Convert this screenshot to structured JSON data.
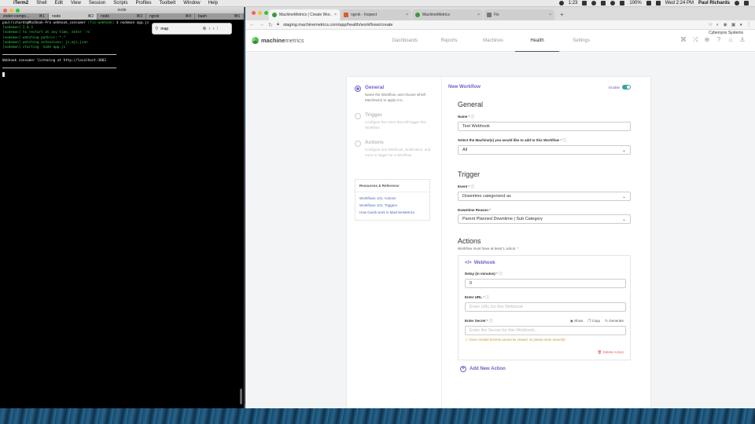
{
  "menubar": {
    "app": "iTerm2",
    "items": [
      "Shell",
      "Edit",
      "View",
      "Session",
      "Scripts",
      "Profiles",
      "Toolbelt",
      "Window",
      "Help"
    ],
    "clock": "Wed 2:24 PM",
    "battery": "100%",
    "time_left": "1:23",
    "user": "Paul Richards"
  },
  "terminal": {
    "title": "node",
    "tabs": [
      {
        "label": "zoder-compo...",
        "shortcut": "⌘1"
      },
      {
        "label": "node",
        "shortcut": "⌘2"
      },
      {
        "label": "node",
        "shortcut": "⌘3"
      },
      {
        "label": "ngrok",
        "shortcut": "⌘4"
      },
      {
        "label": "bash",
        "shortcut": "⌘5"
      }
    ],
    "prompt_user": "paulrichards@MacBook-Pro webhook_consumer",
    "prompt_branch": "(fix-webhook)",
    "prompt_cmd": "$ nodemon app.js",
    "lines": [
      "[nodemon] 2.0.3",
      "[nodemon] to restart at any time, enter `rs`",
      "[nodemon] watching path(s): *.*",
      "[nodemon] watching extensions: js,mjs,json",
      "[nodemon] starting `node app.js`"
    ],
    "listening": "Webhook consumer listening at http://localhost:3002",
    "find_value": "map"
  },
  "browser": {
    "tabs": [
      {
        "label": "MachineMetrics | Create Wor...",
        "icon": "machinemetrics-favicon"
      },
      {
        "label": "ngrok - Inspect",
        "icon": "ngrok-favicon"
      },
      {
        "label": "MachineMetrics",
        "icon": "machinemetrics-favicon"
      },
      {
        "label": "Fix",
        "icon": "fix-favicon"
      }
    ],
    "url": "staging.machinemetrics.com/app/health/workflows/create",
    "profile": "Cybersyss Systems"
  },
  "app": {
    "logo_bold": "machine",
    "logo_thin": "metrics",
    "nav": [
      "Dashboards",
      "Reports",
      "Machines",
      "Health",
      "Settings"
    ],
    "active_nav": "Health"
  },
  "steps": [
    {
      "title": "General",
      "desc": "Name the Workflow, and choose which Machine(s) to apply it to",
      "active": true
    },
    {
      "title": "Trigger",
      "desc": "Configure the event that will trigger this Workflow",
      "active": false
    },
    {
      "title": "Actions",
      "desc": "Configure one Webhook, Notification, and more to trigger for a Workflow",
      "active": false
    }
  ],
  "resources": {
    "heading": "Resources & Reference",
    "links": [
      "Workflows 101: Actions",
      "Workflows 101: Triggers",
      "How Guids work in MachineMetrics"
    ]
  },
  "form": {
    "title": "New Workflow",
    "enable_label": "Enable",
    "general_heading": "General",
    "name_label": "Name",
    "name_value": "Test Webhook",
    "machines_label": "Select the Machine(s) you would like to add to this Workflow",
    "machines_value": "All",
    "trigger_heading": "Trigger",
    "event_label": "Event",
    "event_value": "Downtime categorized as",
    "reason_label": "Downtime Reason",
    "reason_value": "Parent Planned Downtime | Sub Category",
    "actions_heading": "Actions",
    "actions_sub": "Workflow must have at least 1 action.",
    "webhook_title": "Webhook",
    "delay_label": "Delay (in minutes)",
    "delay_value": "0",
    "url_label": "Enter URL",
    "url_placeholder": "Enter URL for this Webhook",
    "secret_label": "Enter Secret",
    "secret_placeholder": "Enter the Secret for this Webhook...",
    "show_label": "Show",
    "copy_label": "Copy",
    "generate_label": "Generate",
    "secret_warning": "Once created Secrets cannot be viewed, so please store securely!",
    "delete_label": "Delete Action",
    "add_action_label": "Add New Action"
  }
}
